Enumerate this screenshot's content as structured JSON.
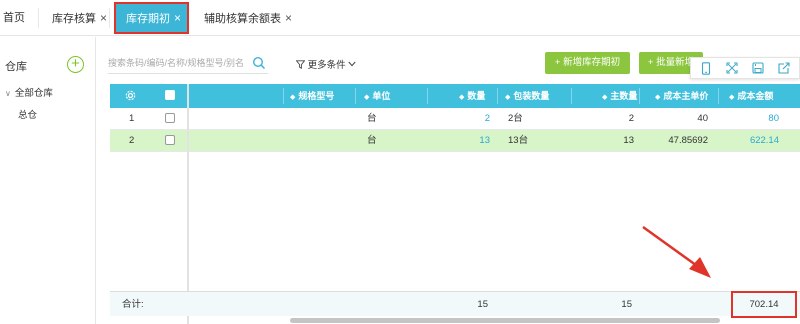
{
  "tabs": [
    {
      "label": "首页",
      "closable": false,
      "active": false
    },
    {
      "label": "库存核算",
      "closable": true,
      "active": false
    },
    {
      "label": "库存期初",
      "closable": true,
      "active": true
    },
    {
      "label": "辅助核算余额表",
      "closable": true,
      "active": false
    }
  ],
  "close_glyph": "×",
  "sidebar": {
    "title": "仓库",
    "add_icon": "plus-circle-icon",
    "tree_root": "全部仓库",
    "tree_child": "总仓"
  },
  "toolbar": {
    "search_placeholder": "搜索条码/编码/名称/规格型号/别名",
    "more_conditions": "更多条件",
    "new_button": "+ 新增库存期初",
    "batch_button": "+ 批量新增"
  },
  "icons": [
    "phone-icon",
    "expand-icon",
    "save-icon",
    "export-icon"
  ],
  "table": {
    "columns": [
      "规格型号",
      "单位",
      "数量",
      "包装数量",
      "主数量",
      "成本主单价",
      "成本金额"
    ],
    "rows": [
      {
        "index": "1",
        "unit": "台",
        "qty": "2",
        "pack_qty": "2台",
        "main_qty": "2",
        "unit_cost": "40",
        "amount": "80"
      },
      {
        "index": "2",
        "unit": "台",
        "qty": "13",
        "pack_qty": "13台",
        "main_qty": "13",
        "unit_cost": "47.85692",
        "amount": "622.14"
      }
    ],
    "footer": {
      "label": "合计:",
      "qty": "15",
      "main_qty": "15",
      "amount": "702.14"
    }
  },
  "colors": {
    "header_bg": "#40c0dc",
    "selected_row": "#d7f5c9",
    "accent_green": "#8cc63f",
    "highlight_red": "#e0342a",
    "link": "#2aa8d0"
  }
}
